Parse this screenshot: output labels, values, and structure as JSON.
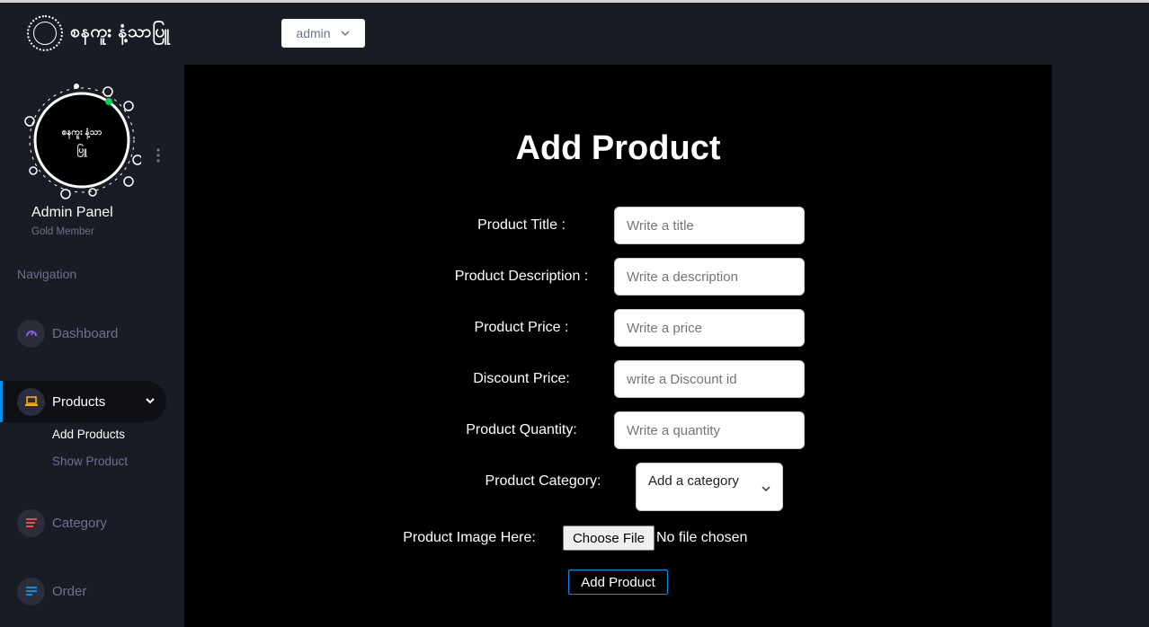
{
  "navbar": {
    "brand_text": "စနကူး နံ့သာပြူ",
    "user_dropdown": "admin"
  },
  "profile": {
    "logo_text": "စနကူး နံ့သာပြူ",
    "name": "Admin Panel",
    "subtitle": "Gold Member"
  },
  "sidebar": {
    "heading": "Navigation",
    "items": [
      {
        "label": "Dashboard",
        "icon": "speedometer-icon",
        "color": "#8f5fe8"
      },
      {
        "label": "Products",
        "icon": "laptop-icon",
        "color": "#ffab00"
      },
      {
        "label": "Category",
        "icon": "list-icon",
        "color": "#fc424a"
      },
      {
        "label": "Order",
        "icon": "message-icon",
        "color": "#0090e7"
      }
    ],
    "sub_items": [
      "Add Products",
      "Show Product"
    ]
  },
  "form": {
    "title": "Add Product",
    "fields": [
      {
        "label": "Product Title :",
        "placeholder": "Write a title"
      },
      {
        "label": "Product Description :",
        "placeholder": "Write a description"
      },
      {
        "label": "Product Price :",
        "placeholder": "Write a price"
      },
      {
        "label": "Discount Price:",
        "placeholder": "write a Discount id"
      },
      {
        "label": "Product Quantity:",
        "placeholder": "Write a quantity"
      }
    ],
    "category_label": "Product Category:",
    "category_value": "Add a category",
    "image_label": "Product Image Here:",
    "file_button": "Choose File",
    "file_status": "No file chosen",
    "submit": "Add Product"
  },
  "colors": {
    "accent": "#0090e7",
    "sidebar_bg": "#191c24",
    "content_bg": "#000000",
    "online": "#00d25b"
  }
}
